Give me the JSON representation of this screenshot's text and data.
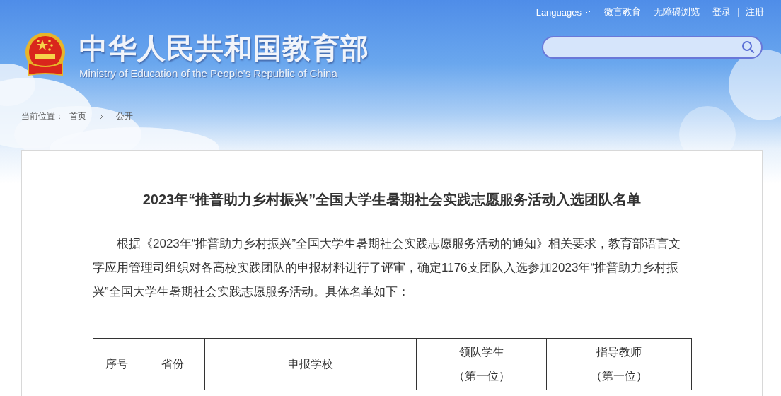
{
  "top_nav": {
    "languages": "Languages",
    "links": [
      "微言教育",
      "无障碍浏览",
      "登录",
      "注册"
    ]
  },
  "logo": {
    "title": "中华人民共和国教育部",
    "subtitle": "Ministry of Education of the People's Republic of China"
  },
  "breadcrumb": {
    "label": "当前位置：",
    "items": [
      "首页",
      "公开"
    ]
  },
  "article": {
    "title": "2023年“推普助力乡村振兴”全国大学生暑期社会实践志愿服务活动入选团队名单",
    "paragraph": "根据《2023年“推普助力乡村振兴”全国大学生暑期社会实践志愿服务活动的通知》相关要求，教育部语言文字应用管理司组织对各高校实践团队的申报材料进行了评审，确定1176支团队入选参加2023年“推普助力乡村振兴”全国大学生暑期社会实践志愿服务活动。具体名单如下：",
    "table": {
      "columns": [
        {
          "lines": [
            "序号"
          ]
        },
        {
          "lines": [
            "省份"
          ]
        },
        {
          "lines": [
            "申报学校"
          ]
        },
        {
          "lines": [
            "领队学生",
            "（第一位）"
          ]
        },
        {
          "lines": [
            "指导教师",
            "（第一位）"
          ]
        }
      ]
    }
  }
}
